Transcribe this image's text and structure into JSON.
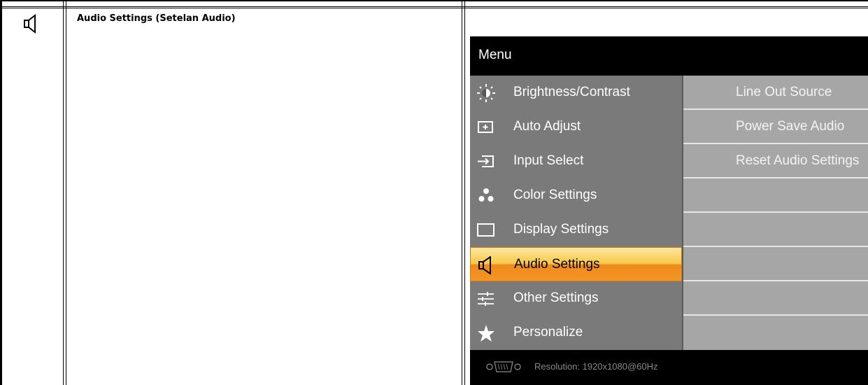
{
  "section": {
    "title": "Audio Settings (Setelan Audio)",
    "icon": "speaker-icon"
  },
  "osd": {
    "title": "Menu",
    "menu_items": [
      {
        "label": "Brightness/Contrast",
        "icon": "brightness-icon"
      },
      {
        "label": "Auto Adjust",
        "icon": "auto-adjust-icon"
      },
      {
        "label": "Input Select",
        "icon": "input-select-icon"
      },
      {
        "label": "Color Settings",
        "icon": "color-settings-icon"
      },
      {
        "label": "Display Settings",
        "icon": "display-settings-icon"
      },
      {
        "label": "Audio Settings",
        "icon": "speaker-icon",
        "selected": true
      },
      {
        "label": "Other Settings",
        "icon": "other-settings-icon"
      },
      {
        "label": "Personalize",
        "icon": "star-icon"
      }
    ],
    "submenu_items": [
      {
        "label": "Line Out Source"
      },
      {
        "label": "Power Save Audio"
      },
      {
        "label": "Reset Audio Settings"
      },
      {
        "label": ""
      },
      {
        "label": ""
      },
      {
        "label": ""
      },
      {
        "label": ""
      },
      {
        "label": ""
      }
    ],
    "footer": {
      "resolution": "Resolution:  1920x1080@60Hz",
      "icon": "vga-connector-icon"
    },
    "colors": {
      "selected_highlight": "#f7c84a",
      "menu_background": "#7a7a7a",
      "submenu_background": "#a6a6a6"
    }
  }
}
